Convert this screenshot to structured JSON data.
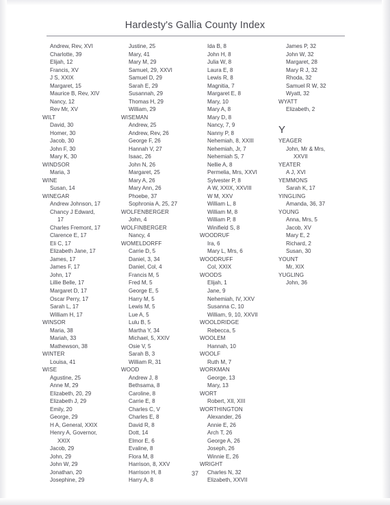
{
  "header": {
    "title": "Hardesty's Gallia County Index"
  },
  "page_number": "37",
  "columns": [
    {
      "name": "column-1",
      "entries": [
        {
          "kind": "given",
          "text": "Andrew, Rev, XVI"
        },
        {
          "kind": "given",
          "text": "Charlotte, 39"
        },
        {
          "kind": "given",
          "text": "Elijah, 12"
        },
        {
          "kind": "given",
          "text": "Francis, XV"
        },
        {
          "kind": "given",
          "text": "J S, XXIX"
        },
        {
          "kind": "given",
          "text": "Margaret, 15"
        },
        {
          "kind": "given",
          "text": "Maurice B, Rev, XIV"
        },
        {
          "kind": "given",
          "text": "Nancy, 12"
        },
        {
          "kind": "given",
          "text": "Rev Mr, XV"
        },
        {
          "kind": "surname",
          "text": "WILT"
        },
        {
          "kind": "given",
          "text": "David, 30"
        },
        {
          "kind": "given",
          "text": "Homer, 30"
        },
        {
          "kind": "given",
          "text": "Jacob, 30"
        },
        {
          "kind": "given",
          "text": "John F, 30"
        },
        {
          "kind": "given",
          "text": "Mary K, 30"
        },
        {
          "kind": "surname",
          "text": "WINDSOR"
        },
        {
          "kind": "given",
          "text": "Maria, 3"
        },
        {
          "kind": "surname",
          "text": "WINE"
        },
        {
          "kind": "given",
          "text": "Susan, 14"
        },
        {
          "kind": "surname",
          "text": "WINEGAR"
        },
        {
          "kind": "given",
          "text": "Andrew Johnson, 17"
        },
        {
          "kind": "given",
          "text": "Chancy J Edward,"
        },
        {
          "kind": "cont",
          "text": "17"
        },
        {
          "kind": "given",
          "text": "Charles Fremont, 17"
        },
        {
          "kind": "given",
          "text": "Clarence E, 17"
        },
        {
          "kind": "given",
          "text": "Eli C, 17"
        },
        {
          "kind": "given",
          "text": "Elizabeth Jane, 17"
        },
        {
          "kind": "given",
          "text": "James, 17"
        },
        {
          "kind": "given",
          "text": "James F, 17"
        },
        {
          "kind": "given",
          "text": "John, 17"
        },
        {
          "kind": "given",
          "text": "Lillie Belle, 17"
        },
        {
          "kind": "given",
          "text": "Margaret D, 17"
        },
        {
          "kind": "given",
          "text": "Oscar Perry, 17"
        },
        {
          "kind": "given",
          "text": "Sarah L, 17"
        },
        {
          "kind": "given",
          "text": "William H, 17"
        },
        {
          "kind": "surname",
          "text": "WINSOR"
        },
        {
          "kind": "given",
          "text": "Maria, 38"
        },
        {
          "kind": "given",
          "text": "Mariah, 33"
        },
        {
          "kind": "given",
          "text": "Mathewson, 38"
        },
        {
          "kind": "surname",
          "text": "WINTER"
        },
        {
          "kind": "given",
          "text": "Louisa, 41"
        },
        {
          "kind": "surname",
          "text": "WISE"
        },
        {
          "kind": "given",
          "text": "Agustine, 25"
        },
        {
          "kind": "given",
          "text": "Anne M, 29"
        },
        {
          "kind": "given",
          "text": "Elizabeth, 20, 29"
        },
        {
          "kind": "given",
          "text": "Elizabeth J, 29"
        },
        {
          "kind": "given",
          "text": "Emily, 20"
        },
        {
          "kind": "given",
          "text": "George, 29"
        },
        {
          "kind": "given",
          "text": "H A, General, XXIX"
        },
        {
          "kind": "given",
          "text": "Henry A, Governor,"
        },
        {
          "kind": "cont",
          "text": "XXIX"
        },
        {
          "kind": "given",
          "text": "Jacob, 29"
        },
        {
          "kind": "given",
          "text": "John, 29"
        },
        {
          "kind": "given",
          "text": "John W, 29"
        },
        {
          "kind": "given",
          "text": "Jonathan, 20"
        },
        {
          "kind": "given",
          "text": "Josephine, 29"
        }
      ]
    },
    {
      "name": "column-2",
      "entries": [
        {
          "kind": "given",
          "text": "Justine, 25"
        },
        {
          "kind": "given",
          "text": "Mary, 41"
        },
        {
          "kind": "given",
          "text": "Mary M, 29"
        },
        {
          "kind": "given",
          "text": "Samuel, 29, XXVI"
        },
        {
          "kind": "given",
          "text": "Samuel D, 29"
        },
        {
          "kind": "given",
          "text": "Sarah E, 29"
        },
        {
          "kind": "given",
          "text": "Susannah, 29"
        },
        {
          "kind": "given",
          "text": "Thomas H, 29"
        },
        {
          "kind": "given",
          "text": "William, 29"
        },
        {
          "kind": "surname",
          "text": "WISEMAN"
        },
        {
          "kind": "given",
          "text": "Andrew, 25"
        },
        {
          "kind": "given",
          "text": "Andrew, Rev, 26"
        },
        {
          "kind": "given",
          "text": "George F, 26"
        },
        {
          "kind": "given",
          "text": "Hannah V, 27"
        },
        {
          "kind": "given",
          "text": "Isaac, 26"
        },
        {
          "kind": "given",
          "text": "John N, 26"
        },
        {
          "kind": "given",
          "text": "Margaret, 25"
        },
        {
          "kind": "given",
          "text": "Mary A, 26"
        },
        {
          "kind": "given",
          "text": "Mary Ann, 26"
        },
        {
          "kind": "given",
          "text": "Phoebe, 37"
        },
        {
          "kind": "given",
          "text": "Sophronia A, 25, 27"
        },
        {
          "kind": "surname",
          "text": "WOLFENBERGER"
        },
        {
          "kind": "given",
          "text": "John, 4"
        },
        {
          "kind": "surname",
          "text": "WOLFINBERGER"
        },
        {
          "kind": "given",
          "text": "Nancy, 4"
        },
        {
          "kind": "surname",
          "text": "WOMELDORFF"
        },
        {
          "kind": "given",
          "text": "Carrie D, 5"
        },
        {
          "kind": "given",
          "text": "Daniel, 3, 34"
        },
        {
          "kind": "given",
          "text": "Daniel, Col, 4"
        },
        {
          "kind": "given",
          "text": "Francis M, 5"
        },
        {
          "kind": "given",
          "text": "Fred M, 5"
        },
        {
          "kind": "given",
          "text": "George E, 5"
        },
        {
          "kind": "given",
          "text": "Harry M, 5"
        },
        {
          "kind": "given",
          "text": "Lewis M, 5"
        },
        {
          "kind": "given",
          "text": "Lue A, 5"
        },
        {
          "kind": "given",
          "text": "Lulu B, 5"
        },
        {
          "kind": "given",
          "text": "Martha Y, 34"
        },
        {
          "kind": "given",
          "text": "Michael, 5, XXIV"
        },
        {
          "kind": "given",
          "text": "Osie V, 5"
        },
        {
          "kind": "given",
          "text": "Sarah B, 3"
        },
        {
          "kind": "given",
          "text": "William R, 31"
        },
        {
          "kind": "surname",
          "text": "WOOD"
        },
        {
          "kind": "given",
          "text": "Andrew J, 8"
        },
        {
          "kind": "given",
          "text": "Bethsama, 8"
        },
        {
          "kind": "given",
          "text": "Caroline, 8"
        },
        {
          "kind": "given",
          "text": "Carrie E, 8"
        },
        {
          "kind": "given",
          "text": "Charles C, V"
        },
        {
          "kind": "given",
          "text": "Charles E, 8"
        },
        {
          "kind": "given",
          "text": "David R, 8"
        },
        {
          "kind": "given",
          "text": "Dott, 14"
        },
        {
          "kind": "given",
          "text": "Elmor E, 6"
        },
        {
          "kind": "given",
          "text": "Evaline, 8"
        },
        {
          "kind": "given",
          "text": "Flora M, 8"
        },
        {
          "kind": "given",
          "text": "Harrison, 8, XXV"
        },
        {
          "kind": "given",
          "text": "Harrison H, 8"
        },
        {
          "kind": "given",
          "text": "Harry A, 8"
        }
      ]
    },
    {
      "name": "column-3",
      "entries": [
        {
          "kind": "given",
          "text": "Ida B, 8"
        },
        {
          "kind": "given",
          "text": "John H, 8"
        },
        {
          "kind": "given",
          "text": "Julia W, 8"
        },
        {
          "kind": "given",
          "text": "Laura E, 8"
        },
        {
          "kind": "given",
          "text": "Lewis R, 8"
        },
        {
          "kind": "given",
          "text": "Magnitia, 7"
        },
        {
          "kind": "given",
          "text": "Margaret E, 8"
        },
        {
          "kind": "given",
          "text": "Mary, 10"
        },
        {
          "kind": "given",
          "text": "Mary A, 8"
        },
        {
          "kind": "given",
          "text": "Mary D, 8"
        },
        {
          "kind": "given",
          "text": "Nancy, 7, 9"
        },
        {
          "kind": "given",
          "text": "Nanny P, 8"
        },
        {
          "kind": "given",
          "text": "Nehemiah, 8, XXIII"
        },
        {
          "kind": "given",
          "text": "Nehemiah, Jr, 7"
        },
        {
          "kind": "given",
          "text": "Nehemiah S, 7"
        },
        {
          "kind": "given",
          "text": "Nellie A, 8"
        },
        {
          "kind": "given",
          "text": "Permelia, Mrs, XXVI"
        },
        {
          "kind": "given",
          "text": "Sylvester P, 8"
        },
        {
          "kind": "given",
          "text": "A W, XXIX, XXVIII"
        },
        {
          "kind": "given",
          "text": "W M, XXV"
        },
        {
          "kind": "given",
          "text": "William L, 8"
        },
        {
          "kind": "given",
          "text": "William M, 8"
        },
        {
          "kind": "given",
          "text": "William P, 8"
        },
        {
          "kind": "given",
          "text": "Winifield S, 8"
        },
        {
          "kind": "surname",
          "text": "WOODRUF"
        },
        {
          "kind": "given",
          "text": "Ira, 6"
        },
        {
          "kind": "given",
          "text": "Mary L, Mrs, 6"
        },
        {
          "kind": "surname",
          "text": "WOODRUFF"
        },
        {
          "kind": "given",
          "text": "Col, XXIX"
        },
        {
          "kind": "surname",
          "text": "WOODS"
        },
        {
          "kind": "given",
          "text": "Elijah, 1"
        },
        {
          "kind": "given",
          "text": "Jane, 9"
        },
        {
          "kind": "given",
          "text": "Nehemiah, IV, XXV"
        },
        {
          "kind": "given",
          "text": "Susanna C, 10"
        },
        {
          "kind": "given",
          "text": "William, 9, 10, XXVII"
        },
        {
          "kind": "surname",
          "text": "WOOLDRIDGE"
        },
        {
          "kind": "given",
          "text": "Rebecca, 5"
        },
        {
          "kind": "surname",
          "text": "WOOLEM"
        },
        {
          "kind": "given",
          "text": "Hannah, 10"
        },
        {
          "kind": "surname",
          "text": "WOOLF"
        },
        {
          "kind": "given",
          "text": "Ruth M, 7"
        },
        {
          "kind": "surname",
          "text": "WORKMAN"
        },
        {
          "kind": "given",
          "text": "George, 13"
        },
        {
          "kind": "given",
          "text": "Mary, 13"
        },
        {
          "kind": "surname",
          "text": "WORT"
        },
        {
          "kind": "given",
          "text": "Robert, XII, XIII"
        },
        {
          "kind": "surname",
          "text": "WORTHINGTON"
        },
        {
          "kind": "given",
          "text": "Alexander, 26"
        },
        {
          "kind": "given",
          "text": "Annie E, 26"
        },
        {
          "kind": "given",
          "text": "Arch T, 26"
        },
        {
          "kind": "given",
          "text": "George A, 26"
        },
        {
          "kind": "given",
          "text": "Joseph, 26"
        },
        {
          "kind": "given",
          "text": "Winnie E, 26"
        },
        {
          "kind": "surname",
          "text": "WRIGHT"
        },
        {
          "kind": "given",
          "text": "Charles N, 32"
        },
        {
          "kind": "given",
          "text": "Elizabeth, XXVII"
        }
      ]
    },
    {
      "name": "column-4",
      "entries": [
        {
          "kind": "given",
          "text": "James P, 32"
        },
        {
          "kind": "given",
          "text": "John W, 32"
        },
        {
          "kind": "given",
          "text": "Margaret, 28"
        },
        {
          "kind": "given",
          "text": "Mary R J, 32"
        },
        {
          "kind": "given",
          "text": "Rhoda, 32"
        },
        {
          "kind": "given",
          "text": "Samuel R W, 32"
        },
        {
          "kind": "given",
          "text": "Wyatt, 32"
        },
        {
          "kind": "surname",
          "text": "WYATT"
        },
        {
          "kind": "given",
          "text": "Elizabeth, 2"
        },
        {
          "kind": "spacer",
          "text": ""
        },
        {
          "kind": "letter",
          "text": "Y"
        },
        {
          "kind": "surname",
          "text": "YEAGER"
        },
        {
          "kind": "given",
          "text": "John, Mr & Mrs,"
        },
        {
          "kind": "cont",
          "text": "XXVII"
        },
        {
          "kind": "surname",
          "text": "YEATER"
        },
        {
          "kind": "given",
          "text": "A J, XVI"
        },
        {
          "kind": "surname",
          "text": "YEMMONS"
        },
        {
          "kind": "given",
          "text": "Sarah K, 17"
        },
        {
          "kind": "surname",
          "text": "YINGLING"
        },
        {
          "kind": "given",
          "text": "Amanda, 36, 37"
        },
        {
          "kind": "surname",
          "text": "YOUNG"
        },
        {
          "kind": "given",
          "text": "Anna, Mrs, 5"
        },
        {
          "kind": "given",
          "text": "Jacob, XV"
        },
        {
          "kind": "given",
          "text": "Mary E, 2"
        },
        {
          "kind": "given",
          "text": "Richard, 2"
        },
        {
          "kind": "given",
          "text": "Susan, 30"
        },
        {
          "kind": "surname",
          "text": "YOUNT"
        },
        {
          "kind": "given",
          "text": "Mr, XIX"
        },
        {
          "kind": "surname",
          "text": "YUGLING"
        },
        {
          "kind": "given",
          "text": "John, 36"
        }
      ]
    }
  ]
}
